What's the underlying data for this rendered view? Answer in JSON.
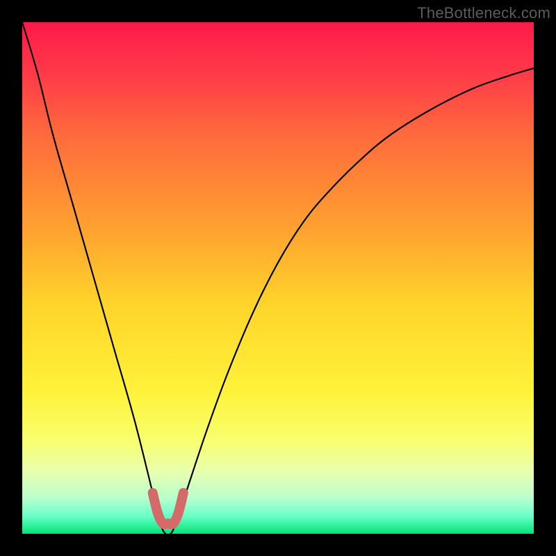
{
  "watermark": "TheBottleneck.com",
  "chart_data": {
    "type": "line",
    "title": "",
    "xlabel": "",
    "ylabel": "",
    "xlim": [
      0,
      100
    ],
    "ylim": [
      0,
      100
    ],
    "series": [
      {
        "name": "bottleneck-curve",
        "x": [
          0,
          3,
          6,
          10,
          14,
          18,
          22,
          25.5,
          27,
          28,
          29,
          30,
          32,
          36,
          40,
          45,
          50,
          55,
          60,
          66,
          72,
          80,
          88,
          95,
          100
        ],
        "values": [
          100,
          90,
          78,
          64,
          50,
          36,
          22,
          8,
          2,
          0,
          0,
          2,
          8,
          20,
          31,
          43,
          53,
          61,
          67,
          73,
          78,
          83,
          87,
          89.5,
          91
        ]
      },
      {
        "name": "optimal-band",
        "x": [
          25.5,
          26.5,
          27.5,
          28.5,
          29.5,
          30.5,
          31.5
        ],
        "values": [
          8,
          4,
          2,
          2,
          2,
          4,
          8
        ]
      }
    ],
    "gradient_stops": [
      {
        "offset": 0.0,
        "color": "#ff1a4a"
      },
      {
        "offset": 0.1,
        "color": "#ff3a49"
      },
      {
        "offset": 0.22,
        "color": "#ff6a3c"
      },
      {
        "offset": 0.4,
        "color": "#ffa030"
      },
      {
        "offset": 0.55,
        "color": "#ffd42a"
      },
      {
        "offset": 0.72,
        "color": "#fff23a"
      },
      {
        "offset": 0.82,
        "color": "#f8ff70"
      },
      {
        "offset": 0.88,
        "color": "#e8ffb0"
      },
      {
        "offset": 0.93,
        "color": "#b8ffce"
      },
      {
        "offset": 0.965,
        "color": "#6affc8"
      },
      {
        "offset": 1.0,
        "color": "#00e676"
      }
    ]
  }
}
